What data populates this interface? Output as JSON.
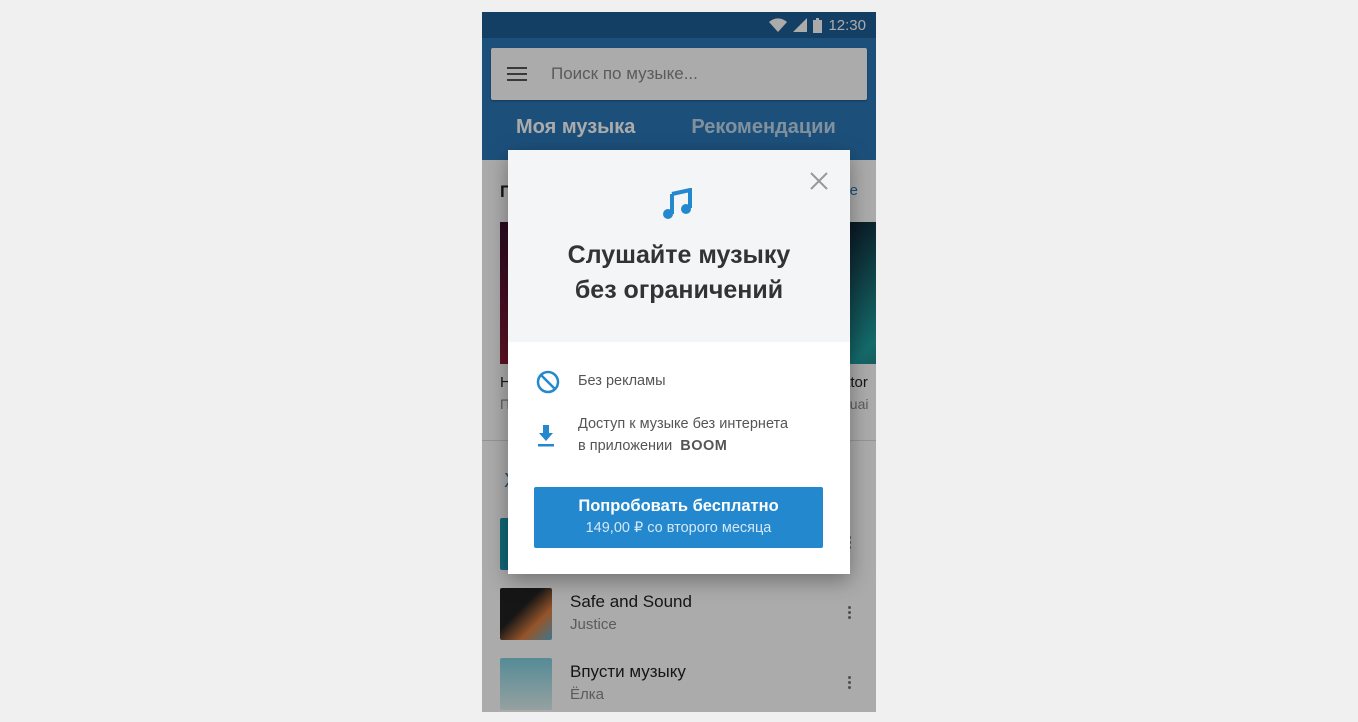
{
  "status_bar": {
    "time": "12:30",
    "icons": [
      "wifi-icon",
      "signal-icon",
      "battery-icon"
    ]
  },
  "search": {
    "placeholder": "Поиск по музыке..."
  },
  "tabs": [
    {
      "label": "Моя музыка",
      "active": true
    },
    {
      "label": "Рекомендации",
      "active": false
    }
  ],
  "background": {
    "section_title_visible": "П",
    "section_link_visible": "е",
    "cards": [
      {
        "title_visible": "Н",
        "subtitle_visible": "П"
      },
      {
        "title_visible": "ator",
        "subtitle_visible": "quai"
      }
    ],
    "second_section_visible": "Х",
    "tracks": [
      {
        "title": "",
        "artist": ""
      },
      {
        "title": "Safe and Sound",
        "artist": "Justice"
      },
      {
        "title": "Впусти музыку",
        "artist": "Ёлка"
      }
    ]
  },
  "modal": {
    "icon": "music-note-icon",
    "title_line1": "Слушайте музыку",
    "title_line2": "без ограничений",
    "features": [
      {
        "icon": "no-ads-icon",
        "text": "Без рекламы"
      },
      {
        "icon": "download-icon",
        "text_line1": "Доступ к музыке без интернета",
        "text_line2": "в приложении",
        "brand": "BOOM"
      }
    ],
    "cta_label": "Попробовать бесплатно",
    "cta_sub": "149,00 ₽ со второго месяца"
  },
  "colors": {
    "accent": "#2488cf",
    "header": "#2a78b8",
    "brand_boom": "#ff2e8a"
  }
}
